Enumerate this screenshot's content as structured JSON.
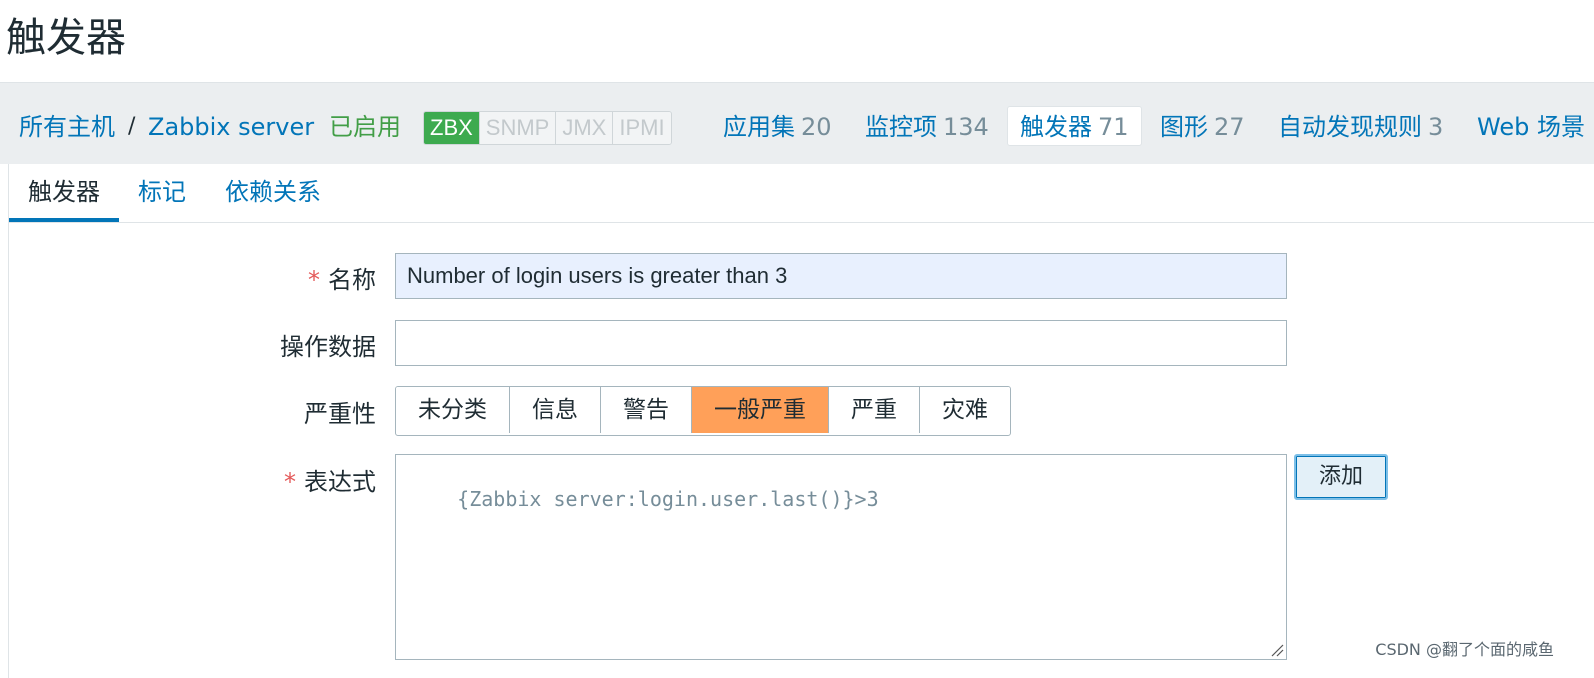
{
  "page": {
    "title": "触发器"
  },
  "breadcrumb": {
    "all_hosts": "所有主机",
    "separator": "/",
    "host": "Zabbix server",
    "status": "已启用"
  },
  "availability": [
    "ZBX",
    "SNMP",
    "JMX",
    "IPMI"
  ],
  "host_nav": [
    {
      "label": "应用集",
      "count": "20"
    },
    {
      "label": "监控项",
      "count": "134"
    },
    {
      "label": "触发器",
      "count": "71"
    },
    {
      "label": "图形",
      "count": "27"
    },
    {
      "label": "自动发现规则",
      "count": "3"
    },
    {
      "label": "Web 场景",
      "count": ""
    }
  ],
  "tabs": [
    "触发器",
    "标记",
    "依赖关系"
  ],
  "form": {
    "name_label": "名称",
    "name_value": "Number of login users is greater than 3",
    "opdata_label": "操作数据",
    "opdata_value": "",
    "severity_label": "严重性",
    "severity_options": [
      "未分类",
      "信息",
      "警告",
      "一般严重",
      "严重",
      "灾难"
    ],
    "severity_selected": "一般严重",
    "expression_label": "表达式",
    "expression_value": "{Zabbix server:login.user.last()}>3",
    "add_button": "添加",
    "required_mark": "*"
  },
  "watermark": "CSDN @翻了个面的咸鱼",
  "colors": {
    "link": "#0275b8",
    "enabled": "#429e47",
    "zbx_on": "#3daa4f",
    "severity_average": "#ffa059",
    "required": "#e45959"
  }
}
